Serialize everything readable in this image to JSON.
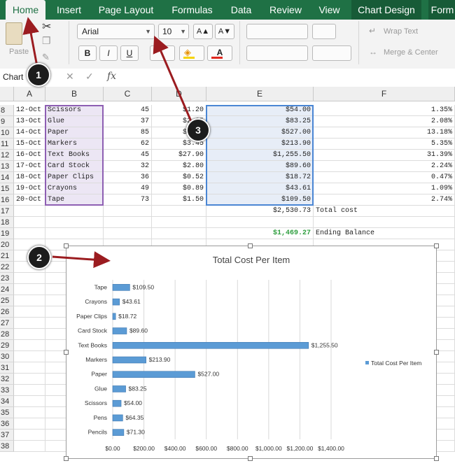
{
  "tabs": [
    {
      "label": "Home",
      "x": 8,
      "w": 57,
      "active": true
    },
    {
      "label": "Insert",
      "x": 71,
      "w": 55
    },
    {
      "label": "Page Layout",
      "x": 135,
      "w": 90
    },
    {
      "label": "Formulas",
      "x": 237,
      "w": 75
    },
    {
      "label": "Data",
      "x": 322,
      "w": 45
    },
    {
      "label": "Review",
      "x": 377,
      "w": 62
    },
    {
      "label": "View",
      "x": 448,
      "w": 45
    },
    {
      "label": "Chart Design",
      "x": 502,
      "w": 100,
      "ctx": true
    },
    {
      "label": "Form",
      "x": 612,
      "w": 40,
      "ctx": true
    }
  ],
  "ribbon": {
    "paste_label": "Paste",
    "font_name": "Arial",
    "font_size": "10",
    "grow_font": "A▲",
    "shrink_font": "A▼",
    "bold": "B",
    "italic": "I",
    "underline": "U",
    "fill_color_label": "A",
    "wrap_text": "Wrap Text",
    "merge_center": "Merge & Center"
  },
  "formula_bar": {
    "name_box": "Chart",
    "fx": "fx"
  },
  "columns": [
    "A",
    "B",
    "C",
    "D",
    "E",
    "F"
  ],
  "rows": [
    {
      "n": "8",
      "a": "12-Oct",
      "b": "Scissors",
      "c": "45",
      "d": "$1.20",
      "e": "$54.00",
      "f": "1.35%"
    },
    {
      "n": "9",
      "a": "13-Oct",
      "b": "Glue",
      "c": "37",
      "d": "$2.25",
      "e": "$83.25",
      "f": "2.08%"
    },
    {
      "n": "10",
      "a": "14-Oct",
      "b": "Paper",
      "c": "85",
      "d": "$6.20",
      "e": "$527.00",
      "f": "13.18%"
    },
    {
      "n": "11",
      "a": "15-Oct",
      "b": "Markers",
      "c": "62",
      "d": "$3.45",
      "e": "$213.90",
      "f": "5.35%"
    },
    {
      "n": "12",
      "a": "16-Oct",
      "b": "Text Books",
      "c": "45",
      "d": "$27.90",
      "e": "$1,255.50",
      "f": "31.39%"
    },
    {
      "n": "13",
      "a": "17-Oct",
      "b": "Card Stock",
      "c": "32",
      "d": "$2.80",
      "e": "$89.60",
      "f": "2.24%"
    },
    {
      "n": "14",
      "a": "18-Oct",
      "b": "Paper Clips",
      "c": "36",
      "d": "$0.52",
      "e": "$18.72",
      "f": "0.47%"
    },
    {
      "n": "15",
      "a": "19-Oct",
      "b": "Crayons",
      "c": "49",
      "d": "$0.89",
      "e": "$43.61",
      "f": "1.09%"
    },
    {
      "n": "16",
      "a": "20-Oct",
      "b": "Tape",
      "c": "73",
      "d": "$1.50",
      "e": "$109.50",
      "f": "2.74%"
    },
    {
      "n": "17",
      "e": "$2,530.73",
      "f_label": "Total cost"
    },
    {
      "n": "18"
    },
    {
      "n": "19",
      "e": "$1,469.27",
      "f_label": "Ending Balance",
      "e_color": "#2e9e3e"
    },
    {
      "n": "20"
    },
    {
      "n": "21"
    },
    {
      "n": "22"
    },
    {
      "n": "23"
    },
    {
      "n": "24"
    },
    {
      "n": "25"
    },
    {
      "n": "26"
    },
    {
      "n": "27"
    },
    {
      "n": "28"
    },
    {
      "n": "29"
    },
    {
      "n": "30"
    },
    {
      "n": "31"
    },
    {
      "n": "32"
    },
    {
      "n": "33"
    },
    {
      "n": "34"
    },
    {
      "n": "35"
    },
    {
      "n": "36"
    },
    {
      "n": "37"
    },
    {
      "n": "38"
    }
  ],
  "callouts": [
    "1",
    "2",
    "3"
  ],
  "chart_data": {
    "type": "bar",
    "orientation": "horizontal",
    "title": "Total Cost Per Item",
    "categories": [
      "Tape",
      "Crayons",
      "Paper Clips",
      "Card Stock",
      "Text Books",
      "Markers",
      "Paper",
      "Glue",
      "Scissors",
      "Pens",
      "Pencils"
    ],
    "series": [
      {
        "name": "Total Cost Per Item",
        "values": [
          109.5,
          43.61,
          18.72,
          89.6,
          1255.5,
          213.9,
          527.0,
          83.25,
          54.0,
          64.35,
          71.3
        ],
        "color": "#5b9bd5"
      }
    ],
    "data_labels": [
      "$109.50",
      "$43.61",
      "$18.72",
      "$89.60",
      "$1,255.50",
      "$213.90",
      "$527.00",
      "$83.25",
      "$54.00",
      "$64.35",
      "$71.30"
    ],
    "xlim": [
      0,
      1400
    ],
    "x_ticks": [
      "$0.00",
      "$200.00",
      "$400.00",
      "$600.00",
      "$800.00",
      "$1,000.00",
      "$1,200.00",
      "$1,400.00"
    ],
    "grid": true,
    "legend": "right"
  },
  "colors": {
    "excel_green": "#1f7145",
    "arrow": "#9b1c20",
    "bar": "#5b9bd5"
  }
}
